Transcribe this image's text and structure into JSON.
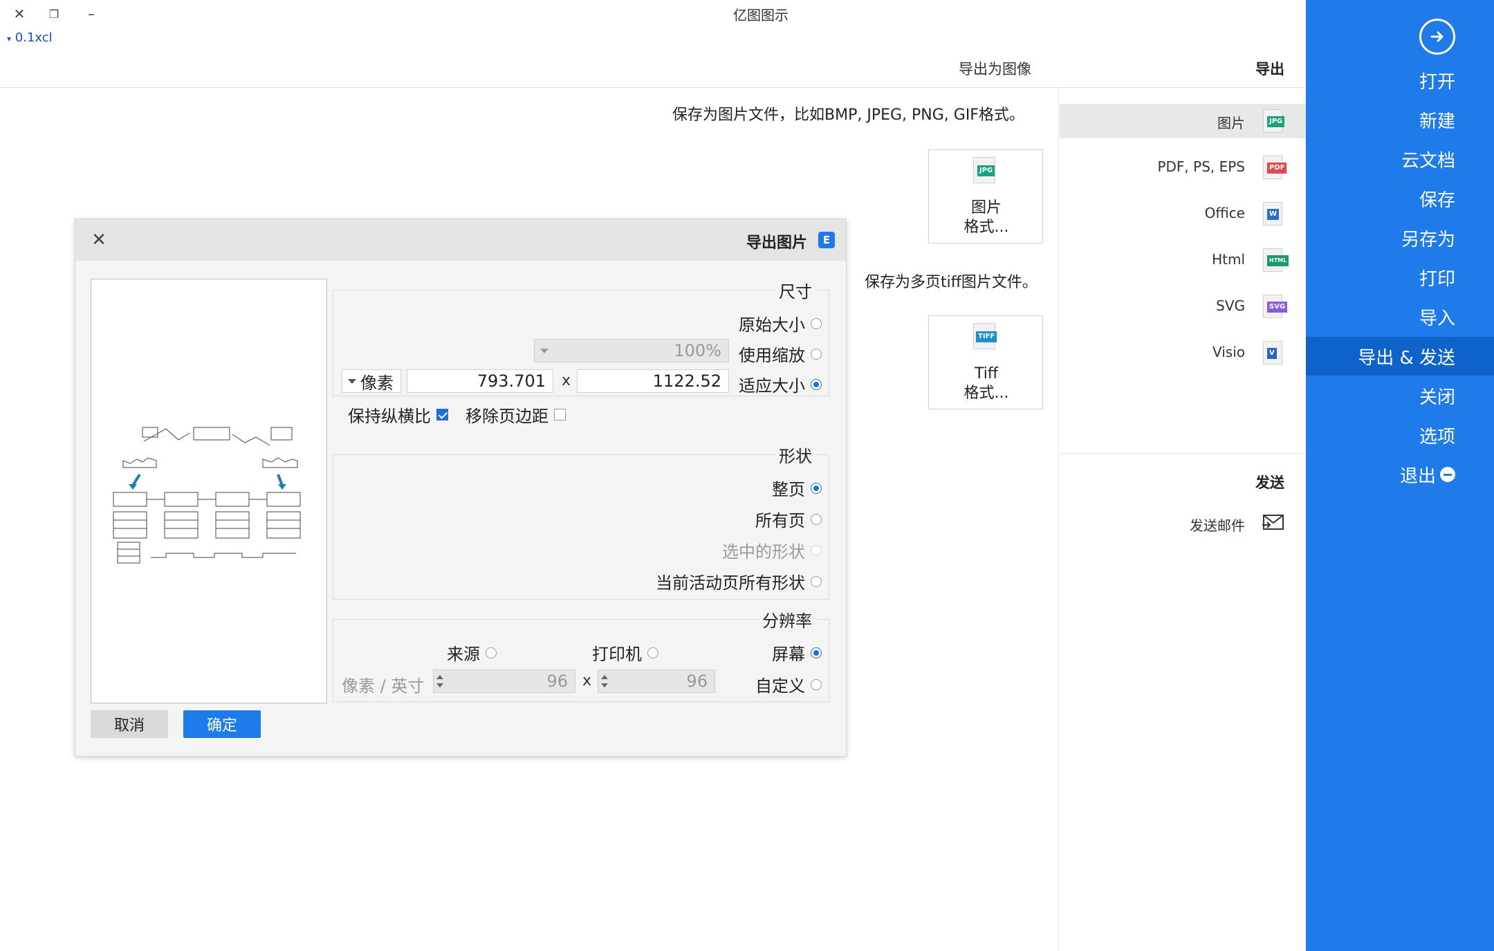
{
  "window": {
    "title": "亿图图示",
    "version": "0.1xcl",
    "buttons": {
      "close": "✕",
      "restore": "❐",
      "minimize": "–"
    }
  },
  "sidebar": {
    "items": [
      {
        "label": "打开"
      },
      {
        "label": "新建"
      },
      {
        "label": "云文档"
      },
      {
        "label": "保存"
      },
      {
        "label": "另存为"
      },
      {
        "label": "打印"
      },
      {
        "label": "导入"
      },
      {
        "label": "导出 & 发送",
        "active": true
      },
      {
        "label": "关闭"
      },
      {
        "label": "选项"
      },
      {
        "label": "退出"
      }
    ]
  },
  "export_panel": {
    "heading": "导出",
    "breadcrumb": "导出为图像",
    "formats": [
      {
        "label": "图片",
        "tag": "JPG",
        "tag_color": "#1aa37a",
        "selected": true
      },
      {
        "label": "PDF, PS, EPS",
        "tag": "PDF",
        "tag_color": "#e04a4a"
      },
      {
        "label": "Office",
        "tag": "W",
        "tag_color": "#2b6fd1"
      },
      {
        "label": "Html",
        "tag": "HTML",
        "tag_color": "#1a9a6a"
      },
      {
        "label": "SVG",
        "tag": "SVG",
        "tag_color": "#8a5bd8"
      },
      {
        "label": "Visio",
        "tag": "V",
        "tag_color": "#2a64c8"
      }
    ],
    "send_heading": "发送",
    "send_item": "发送邮件",
    "image_desc": "保存为图片文件，比如BMP, JPEG, PNG, GIF格式。",
    "image_card": {
      "line1": "图片",
      "line2": "格式...",
      "tag": "JPG"
    },
    "tiff_desc": "保存为多页tiff图片文件。",
    "tiff_card": {
      "line1": "Tiff",
      "line2": "格式...",
      "tag": "TIFF"
    }
  },
  "dialog": {
    "title": "导出图片",
    "logo": "E",
    "close": "✕",
    "size_group": {
      "title": "尺寸",
      "original": "原始大小",
      "use_zoom": "使用缩放",
      "zoom_value": "100%",
      "fit_size": "适应大小",
      "width": "1122.52",
      "height": "793.701",
      "unit": "像素",
      "remove_margin": "移除页边距",
      "keep_ratio": "保持纵横比"
    },
    "shape_group": {
      "title": "形状",
      "whole_page": "整页",
      "all_pages": "所有页",
      "selected_shapes": "选中的形状",
      "current_page_all": "当前活动页所有形状"
    },
    "resolution_group": {
      "title": "分辨率",
      "screen": "屏幕",
      "printer": "打印机",
      "source": "来源",
      "custom": "自定义",
      "dpi_x": "96",
      "dpi_y": "96",
      "unit": "像素 / 英寸"
    },
    "ok": "确定",
    "cancel": "取消"
  }
}
